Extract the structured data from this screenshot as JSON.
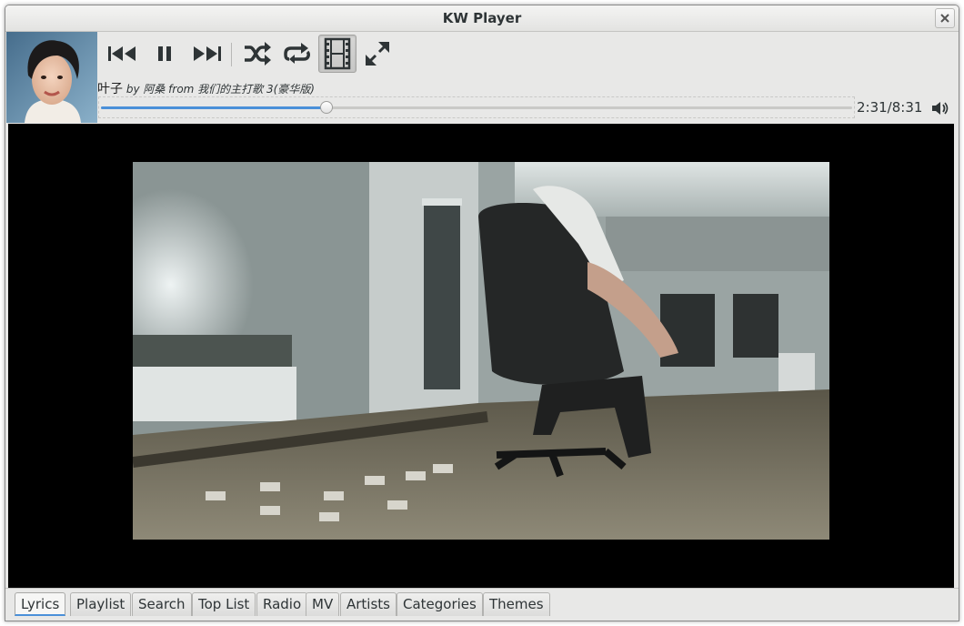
{
  "window": {
    "title": "KW Player",
    "close_icon": "close-icon"
  },
  "album_art": {
    "description": "album-cover"
  },
  "toolbar": {
    "buttons": [
      {
        "name": "previous-button",
        "icon": "skip-back-icon"
      },
      {
        "name": "pause-button",
        "icon": "pause-icon"
      },
      {
        "name": "next-button",
        "icon": "skip-forward-icon"
      },
      {
        "name": "shuffle-button",
        "icon": "shuffle-icon"
      },
      {
        "name": "repeat-button",
        "icon": "repeat-icon"
      },
      {
        "name": "video-button",
        "icon": "film-icon",
        "active": true
      },
      {
        "name": "fullscreen-button",
        "icon": "expand-icon"
      }
    ]
  },
  "now_playing": {
    "title": "叶子",
    "meta": "by 阿桑 from 我们的主打歌 3(豪华版)",
    "elapsed": "2:31",
    "total": "8:31",
    "time_text": "2:31/8:31",
    "progress_fraction": 0.3
  },
  "tabs": {
    "items": [
      "Lyrics",
      "Playlist",
      "Search",
      "Top List",
      "Radio",
      "MV",
      "Artists",
      "Categories",
      "Themes"
    ],
    "active": "Lyrics"
  },
  "colors": {
    "accent": "#4a90d9",
    "video_bg": "#000000"
  }
}
